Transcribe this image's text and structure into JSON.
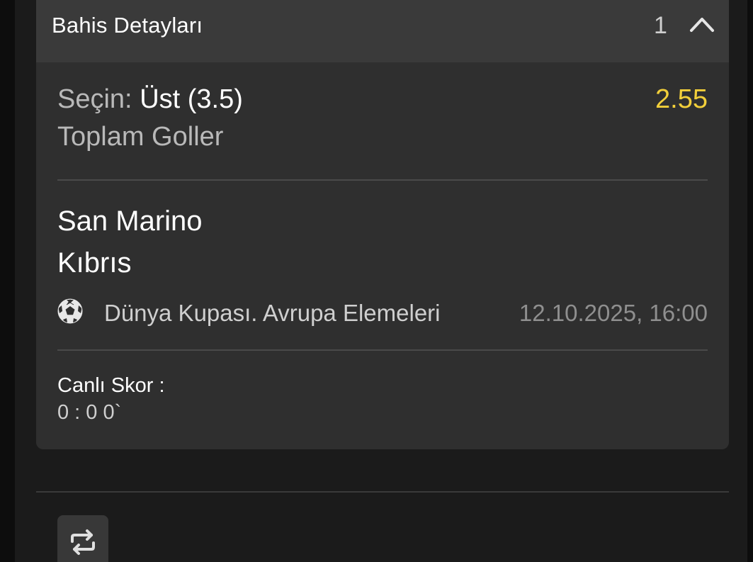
{
  "bet_details": {
    "title": "Bahis Detayları",
    "count": "1",
    "selection": {
      "label": "Seçin:",
      "value": "Üst (3.5)",
      "odds": "2.55",
      "market": "Toplam Goller"
    },
    "match": {
      "home_team": "San Marino",
      "away_team": "Kıbrıs",
      "league": "Dünya Kupası. Avrupa Elemeleri",
      "datetime": "12.10.2025, 16:00",
      "sport_icon": "soccer-ball-icon"
    },
    "live_score": {
      "label": "Canlı Skor :",
      "value": "0 : 0 0`"
    }
  },
  "colors": {
    "background": "#1b1b1b",
    "card": "#2f2f2f",
    "card_header": "#3a3a3a",
    "odds": "#f2cf3a",
    "primary_text": "#ffffff",
    "secondary_text": "#b9b9b9",
    "muted_text": "#8f8f8f"
  },
  "icons": {
    "collapse": "chevron-up-icon",
    "action": "repeat-icon"
  }
}
